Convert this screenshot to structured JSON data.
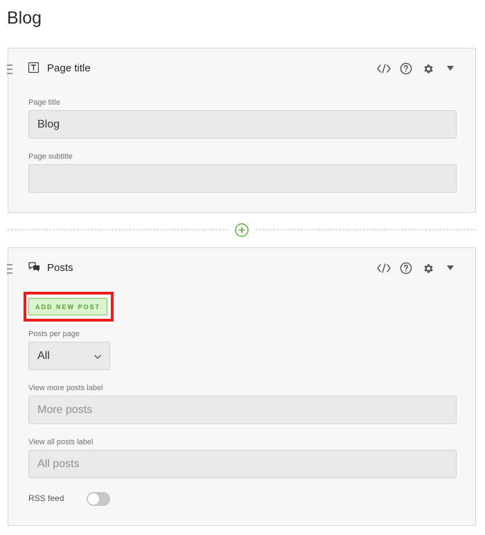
{
  "page": {
    "heading": "Blog"
  },
  "page_title_section": {
    "title": "Page title",
    "icon": "text-icon",
    "fields": {
      "title_label": "Page title",
      "title_value": "Blog",
      "subtitle_label": "Page subtitle",
      "subtitle_value": ""
    }
  },
  "posts_section": {
    "title": "Posts",
    "icon": "chat-bubbles-icon",
    "add_button_label": "ADD NEW POST",
    "posts_per_page_label": "Posts per page",
    "posts_per_page_value": "All",
    "view_more_label": "View more posts label",
    "view_more_placeholder": "More posts",
    "view_all_label": "View all posts label",
    "view_all_placeholder": "All posts",
    "rss_label": "RSS feed",
    "rss_enabled": false
  },
  "tools": [
    "code-icon",
    "help-icon",
    "gear-icon",
    "collapse-arrow-icon"
  ],
  "colors": {
    "accent_green": "#4fa02c",
    "highlight_red": "#ee1b1b",
    "panel_bg": "#f7f7f7",
    "input_bg": "#eaeaea"
  }
}
